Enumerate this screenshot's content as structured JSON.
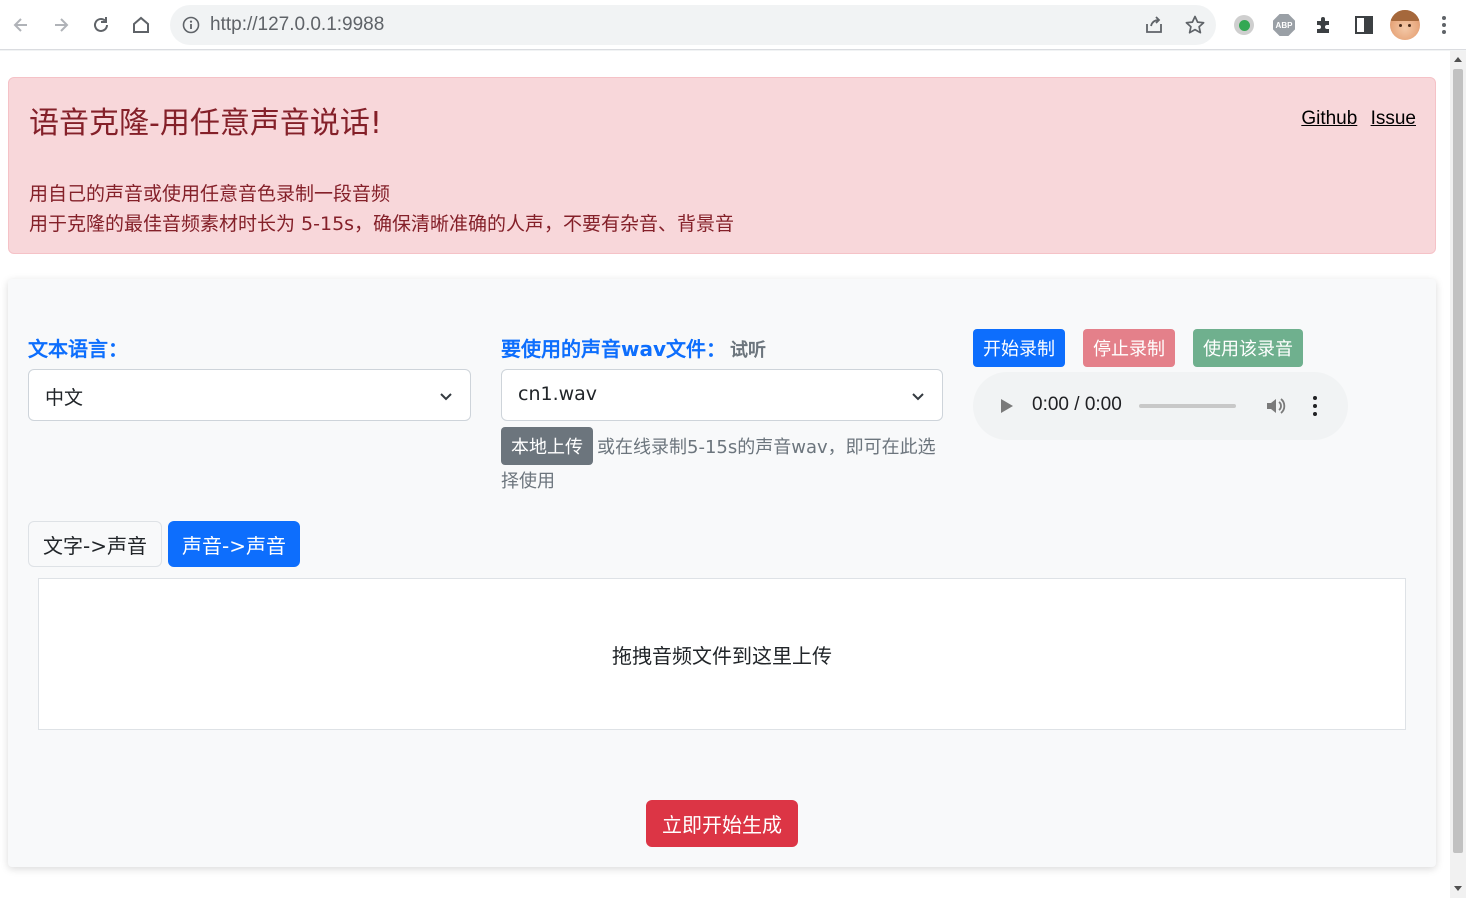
{
  "browser": {
    "url": "http://127.0.0.1:9988",
    "extensions": [
      "green-dot-extension",
      "adblock-plus-extension",
      "puzzle-extensions"
    ],
    "abp_label": "ABP"
  },
  "header": {
    "title": "语音克隆-用任意声音说话!",
    "links": [
      "Github",
      "Issue"
    ],
    "description_line1": "用自己的声音或使用任意音色录制一段音频",
    "description_line2": "用于克隆的最佳音频素材时长为 5-15s，确保清晰准确的人声，不要有杂音、背景音"
  },
  "language": {
    "label": "文本语言：",
    "selected": "中文"
  },
  "voice": {
    "label": "要使用的声音wav文件：",
    "preview_link": "试听",
    "selected": "cn1.wav",
    "upload_button": "本地上传",
    "hint": "或在线录制5-15s的声音wav，即可在此选择使用"
  },
  "recording": {
    "start_button": "开始录制",
    "stop_button": "停止录制",
    "use_button": "使用该录音",
    "player_time": "0:00 / 0:00"
  },
  "tabs": [
    {
      "label": "文字->声音",
      "active": false
    },
    {
      "label": "声音->声音",
      "active": true
    }
  ],
  "dropzone": {
    "text": "拖拽音频文件到这里上传"
  },
  "generate_button": "立即开始生成",
  "colors": {
    "primary": "#0d6efd",
    "danger": "#dc3545",
    "alert_bg": "#f8d7da",
    "alert_text": "#842029",
    "secondary": "#6c757d"
  }
}
